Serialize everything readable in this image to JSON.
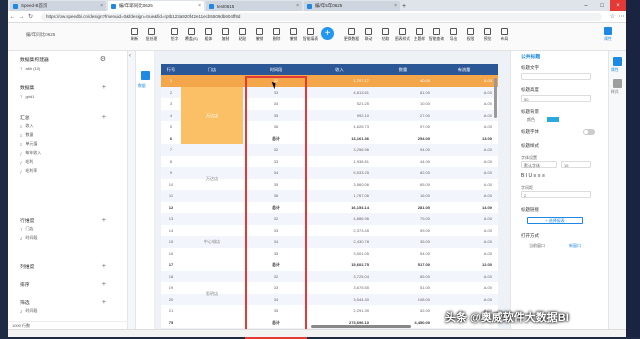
{
  "browser": {
    "tabs": [
      {
        "label": "Speed-B首页",
        "active": false
      },
      {
        "label": "编/年耶同比0625",
        "active": true
      },
      {
        "label": "test0615",
        "active": false
      },
      {
        "label": "编/年5年0625",
        "active": false
      }
    ],
    "url": "https://ow.speedbi.cn/design?fmenuid=0&fdesign=true&fid=rptb123a920f42e11ecb5509db604ff8d"
  },
  "app": {
    "doc_title": "编/年同比0625",
    "tools_left": [
      "刷新",
      "批处理",
      "铅字",
      "覆盖(S)",
      "粗体",
      "复制",
      "粘贴",
      "撤销",
      "删除",
      "撤销",
      "智能填表"
    ],
    "tools_right": [
      "更换数据",
      "联动",
      "钻取",
      "图表样式",
      "主题样",
      "智能查询",
      "导出",
      "权限",
      "预览",
      "布局"
    ],
    "right_button": "属性",
    "accent": "#1e88e5"
  },
  "left_panel": {
    "sections": [
      {
        "title": "数据集构建器",
        "fields": [
          "a8h (10)"
        ]
      },
      {
        "title": "数据集",
        "fields": [
          "grid1"
        ]
      },
      {
        "title": "汇总",
        "fields": [
          "收入",
          "数量",
          "单元值",
          "每年收入",
          "毛利",
          "毛利率"
        ]
      },
      {
        "title": "行维度",
        "fields": [
          "门店",
          "时间段"
        ]
      },
      {
        "title": "列维度",
        "fields": []
      },
      {
        "title": "排序",
        "fields": []
      },
      {
        "title": "筛选",
        "fields": [
          "时间段"
        ]
      }
    ],
    "footer": "1000 行数"
  },
  "side_tool": {
    "label": "数据"
  },
  "table": {
    "headers": [
      "行号",
      "门店",
      "时间段",
      "收入",
      "数量",
      "有流量"
    ],
    "rows": [
      {
        "n": "1",
        "store": "",
        "p": "32",
        "rev": "1,707.17",
        "qty": "40.00",
        "flow": "A.00",
        "kind": "sel"
      },
      {
        "n": "2",
        "store": "",
        "p": "33",
        "rev": "4,813.61",
        "qty": "81.00",
        "flow": "A.00",
        "kind": "alt"
      },
      {
        "n": "3",
        "store": "",
        "p": "34",
        "rev": "521.25",
        "qty": "10.00",
        "flow": "A.00",
        "kind": "norm"
      },
      {
        "n": "4",
        "store": "万达店",
        "p": "35",
        "rev": "992.10",
        "qty": "27.00",
        "flow": "A.00",
        "kind": "alt"
      },
      {
        "n": "5",
        "store": "",
        "p": "36",
        "rev": "4,626.73",
        "qty": "97.00",
        "flow": "A.00",
        "kind": "norm"
      },
      {
        "n": "6",
        "store": "",
        "p": "总计",
        "rev": "13,161.36",
        "qty": "254.00",
        "flow": "13.00",
        "kind": "tot"
      },
      {
        "n": "7",
        "store": "",
        "p": "32",
        "rev": "3,256.96",
        "qty": "94.00",
        "flow": "A.00",
        "kind": "alt"
      },
      {
        "n": "8",
        "store": "",
        "p": "33",
        "rev": "1,938.81",
        "qty": "44.00",
        "flow": "A.00",
        "kind": "norm"
      },
      {
        "n": "9",
        "store": "万达店",
        "p": "34",
        "rev": "5,533.25",
        "qty": "82.00",
        "flow": "A.00",
        "kind": "alt"
      },
      {
        "n": "10",
        "store": "",
        "p": "35",
        "rev": "3,560.06",
        "qty": "65.00",
        "flow": "A.00",
        "kind": "norm"
      },
      {
        "n": "11",
        "store": "",
        "p": "36",
        "rev": "1,767.06",
        "qty": "16.00",
        "flow": "A.00",
        "kind": "alt"
      },
      {
        "n": "12",
        "store": "",
        "p": "总计",
        "rev": "16,154.14",
        "qty": "281.00",
        "flow": "14.00",
        "kind": "tot"
      },
      {
        "n": "13",
        "store": "",
        "p": "32",
        "rev": "4,886.96",
        "qty": "79.00",
        "flow": "A.00",
        "kind": "alt"
      },
      {
        "n": "14",
        "store": "",
        "p": "33",
        "rev": "2,373.45",
        "qty": "59.00",
        "flow": "A.00",
        "kind": "norm"
      },
      {
        "n": "15",
        "store": "中心城店",
        "p": "34",
        "rev": "2,430.78",
        "qty": "35.00",
        "flow": "A.00",
        "kind": "alt"
      },
      {
        "n": "16",
        "store": "",
        "p": "35",
        "rev": "3,501.05",
        "qty": "54.00",
        "flow": "A.00",
        "kind": "norm"
      },
      {
        "n": "17",
        "store": "",
        "p": "总计",
        "rev": "15,602.75",
        "qty": "517.00",
        "flow": "12.00",
        "kind": "tot"
      },
      {
        "n": "18",
        "store": "",
        "p": "32",
        "rev": "3,725.04",
        "qty": "65.00",
        "flow": "A.00",
        "kind": "alt"
      },
      {
        "n": "19",
        "store": "",
        "p": "33",
        "rev": "3,675.55",
        "qty": "51.00",
        "flow": "A.00",
        "kind": "norm"
      },
      {
        "n": "20",
        "store": "思明店",
        "p": "34",
        "rev": "3,544.40",
        "qty": "108.00",
        "flow": "A.00",
        "kind": "alt"
      },
      {
        "n": "21",
        "store": "",
        "p": "35",
        "rev": "2,291.39",
        "qty": "52.00",
        "flow": "A.00",
        "kind": "norm"
      },
      {
        "n": "75",
        "store": "",
        "p": "总计",
        "rev": "273,696.10",
        "qty": "4,450.00",
        "flow": "",
        "kind": "tot"
      }
    ]
  },
  "right_panel": {
    "title": "公共标题",
    "labels": {
      "title_text": "标题文字",
      "title_height": "标题高度",
      "title_height_val": "50",
      "title_bg": "标题背景",
      "title_bg_opt": "颜色",
      "title_font": "标题字体",
      "title_style": "标题样式",
      "font_settings": "字体设置",
      "font_family": "默认字体",
      "font_size": "15",
      "letter_spacing": "字间距",
      "letter_spacing_val": "2",
      "title_link": "标题链接",
      "add_link": "+ 选择报表",
      "open_mode": "打开方式",
      "open_opt1": "当前窗口",
      "open_opt2": "新窗口"
    },
    "swatch_color": "#29a9e0"
  },
  "right_strip": {
    "items": [
      "属性",
      "样式"
    ]
  },
  "watermark": "头条 @奥威软件大数据BI"
}
